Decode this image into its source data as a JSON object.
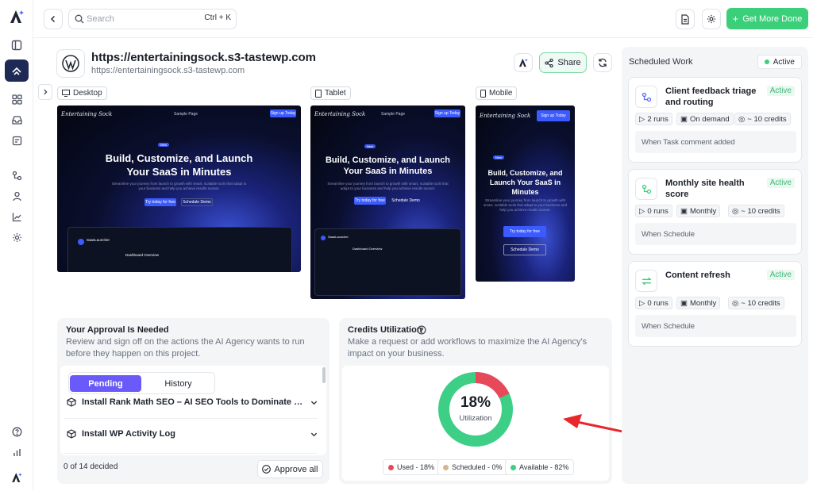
{
  "search": {
    "placeholder": "Search",
    "shortcut": "Ctrl + K"
  },
  "header": {
    "cta_label": "Get More Done"
  },
  "site": {
    "title": "https://entertainingsock.s3-tastewp.com",
    "url": "https://entertainingsock.s3-tastewp.com",
    "share_label": "Share"
  },
  "devices": [
    {
      "label": "Desktop"
    },
    {
      "label": "Tablet"
    },
    {
      "label": "Mobile"
    }
  ],
  "preview": {
    "brand": "Entertaining Sock",
    "nav": "Sample Page",
    "signup": "Sign up Today",
    "headline": "Build, Customize, and Launch Your SaaS in Minutes",
    "tag": "New",
    "tag_text": "Version 2.0 is officially live",
    "sub": "Streamline your journey from launch to growth with smart, scalable tools that adapt to your business and help you achieve results sooner.",
    "cta1": "Try today for free",
    "cta2": "Schedule Demo",
    "dash_title": "Dashboard Overview",
    "app_name": "SaasLauncher"
  },
  "approval": {
    "title": "Your Approval Is Needed",
    "desc": "Review and sign off on the actions the AI Agency wants to run before they happen on this project.",
    "tabs": [
      "Pending",
      "History"
    ],
    "items": [
      {
        "label": "Install Rank Math SEO – AI SEO Tools to Dominate SEO Rankings"
      },
      {
        "label": "Install WP Activity Log"
      }
    ],
    "count": "0 of 14 decided",
    "approve_all": "Approve all"
  },
  "credits": {
    "title": "Credits Utilization",
    "desc": "Make a request or add workflows to maximize the AI Agency's impact on your business.",
    "percent": "18%",
    "percent_label": "Utilization",
    "used": 18,
    "scheduled": 0,
    "available": 82,
    "legend": [
      {
        "label": "Used - 18%",
        "color": "#e8495a"
      },
      {
        "label": "Scheduled - 0%",
        "color": "#d8b48a"
      },
      {
        "label": "Available - 82%",
        "color": "#3ecf86"
      }
    ],
    "colors": {
      "used": "#e8495a",
      "available": "#3ecf86"
    }
  },
  "scheduled": {
    "title": "Scheduled Work",
    "status": "Active",
    "items": [
      {
        "title": "Client feedback triage and routing",
        "badge": "Active",
        "runs": "2 runs",
        "freq": "On demand",
        "credits": "~ 10 credits",
        "trigger": "When Task comment added"
      },
      {
        "title": "Monthly site health score",
        "badge": "Active",
        "runs": "0 runs",
        "freq": "Monthly",
        "credits": "~ 10 credits",
        "trigger": "When Schedule"
      },
      {
        "title": "Content refresh",
        "badge": "Active",
        "runs": "0 runs",
        "freq": "Monthly",
        "credits": "~ 10 credits",
        "trigger": "When Schedule"
      }
    ]
  },
  "accent": "#6a5af9",
  "success": "#3ccf7a"
}
